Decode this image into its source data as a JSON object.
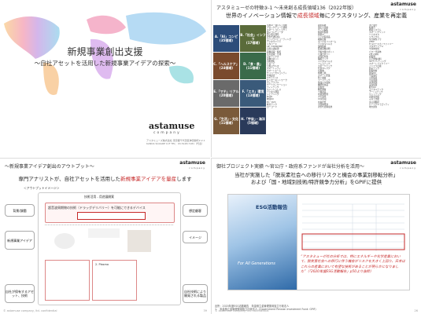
{
  "slide1": {
    "title": "新規事業創出支援",
    "subtitle": "～自社アセットを活用した新規事業アイデアの探索～",
    "logo": "astamuse",
    "logo_sub": "company",
    "address": "アスタミューズ株式会社 東京都千代田区神田錦町2-2-1 KANDA SQUARE 11F TEL：03-5148-7181（代表）"
  },
  "slide2": {
    "title": "アスタミューゼの特徴③-1 ～未来創る成長領域136（2022年版）",
    "heading_pre": "世界のイノベーション情報で",
    "heading_red": "成長領域",
    "heading_post": "毎にクラスタリング、産業を再定義",
    "logo": "astamuse",
    "logo_sub": "company",
    "tiles": [
      {
        "label": "A.「AI」コンピ",
        "sub": "(35領域)",
        "color": "#2d4d7a"
      },
      {
        "label": "B.「社会」インフラ",
        "sub": "(17領域)",
        "color": "#5a6b3a"
      },
      {
        "label": "C.「ヘルスケア」",
        "sub": "(24領域)",
        "color": "#7a4a2d"
      },
      {
        "label": "D.「食・農」",
        "sub": "(11領域)",
        "color": "#3a6b4a"
      },
      {
        "label": "E.「マテ」リアル",
        "sub": "(20領域)",
        "color": "#6a6a6a"
      },
      {
        "label": "F.「エネ」環境",
        "sub": "(13領域)",
        "color": "#3a5a7a"
      },
      {
        "label": "G.「生活」・文化",
        "sub": "(11領域)",
        "color": "#7a5a3a"
      },
      {
        "label": "H.「宇宙」・海洋",
        "sub": "(5領域)",
        "color": "#2a3a5a"
      }
    ],
    "list_col1": [
      "汎用AI・強い人工知能",
      "ブロックチェーン技術",
      "スマートコントラクト",
      "量子コンピュータ",
      "量子暗号通信",
      "次世代通信6G",
      "エッジコンピューティング",
      "デジタルツイン",
      "メタバース",
      "XR（VR/AR/MR）",
      "自然言語処理",
      "画像認識・解析",
      "音声認識・合成",
      "ロボティクス",
      "協働ロボット",
      "自動運転",
      "ドローン",
      "空飛ぶクルマ",
      "スマートシティ",
      "スマートホーム",
      "サイバーセキュリティ",
      "生体認証",
      "IoTデバイス",
      "センサーネットワーク",
      "ウェアラブル",
      "ゲーミフィケーション",
      "フィンテック",
      "キャッシュレス",
      "デジタル通貨",
      "シェアリング",
      "MaaS",
      "物流DX",
      "EC・D2C",
      "教育テック",
      "ローコード"
    ],
    "list_col2": [
      "再生医療",
      "遺伝子治療",
      "ゲノム編集",
      "個別化医療",
      "創薬AI",
      "バイオ医薬品",
      "細胞培養",
      "マイクロバイオーム",
      "デジタルヘルス",
      "遠隔医療",
      "医療画像診断",
      "手術支援ロボット",
      "介護ロボット",
      "認知症対策",
      "睡眠テック",
      "メンタルヘルス",
      "フェムテック",
      "スポーツテック",
      "代替タンパク",
      "培養肉",
      "植物工場",
      "スマート農業",
      "陸上養殖",
      "フードテック",
      "食品ロス削減",
      "機能性食品",
      "昆虫食",
      "精密発酵",
      "土壌改良",
      "水資源管理",
      "大気浄化",
      "CO2回収",
      "水素社会",
      "全固体電池",
      "次世代太陽電池"
    ],
    "list_col3": [
      "洋上風力",
      "核融合",
      "蓄電システム",
      "スマートグリッド",
      "バイオマス",
      "リサイクル",
      "生分解性プラ",
      "CFRP",
      "セルロースナノファイバー",
      "メタマテリアル",
      "半導体材料",
      "パワー半導体",
      "2次元材料",
      "超電導",
      "自己修復材料",
      "3Dプリンティング",
      "スマートファクトリー",
      "インフラ点検",
      "防災テック",
      "耐震技術",
      "建設DX",
      "宇宙旅行",
      "小型衛星",
      "宇宙資源",
      "海洋資源",
      "深海探査",
      "観光DX",
      "エンタメテック",
      "アート×テック",
      "ペットテック",
      "高齢者支援",
      "子育て支援",
      "多言語翻訳",
      "パーソナルモビリティ",
      "地方創生"
    ]
  },
  "slide3": {
    "title": "～新規事業アイデア創出のアウトプット～",
    "heading_pre": "専門アナリストが、自社アセットを活用した",
    "heading_red": "新規事業アイデアを量産",
    "heading_post": "します",
    "label_outline": "＜アウトプットイメージ＞",
    "tab_a": "技術活用 - 用途展開案",
    "panel_title": "超音波周期物の技術（ドラッグデリバリー）を可能にできるデバイス",
    "left_boxes": [
      "背景/課題",
      "新規事業アイデア",
      "自社が保有するアセット、技術"
    ],
    "right_boxes": [
      "想定顧客",
      "イメージ",
      "自社技術により開発される製品"
    ],
    "card_title": "2. Plasma",
    "footer_left": "© astamuse company, ltd. confidential",
    "page": "39"
  },
  "slide4": {
    "title": "御社プロジェクト実績 ～官公庁・政府系ファンドが当社分析を活用～",
    "heading_line1": "当社が実施した「脱炭素社会への移行リスクと機会の事業別移転分析」",
    "heading_line2": "および「国・地域別技術/特許競争力分析」をGPIFに提供",
    "book_title": "ESG活動報告",
    "book_label": "For All Generations",
    "quote": "“アスタミューゼ社の分析では、特にエネルギーや化学産業において、脱炭素社会への移行に伴う機会がリスクを大きく上回り、日本はこれらの産業において有望な技術があることが明らかになりました”（「2020年度ESG活動報告」p50より抜粋）",
    "note1": "出所：2020年度ESG活動報告　年金積立金管理運用独立行政法人",
    "note2": "1.　年金積立金管理運用独立行政法人（Government Pension Investment Fund: GPIF）",
    "footer_left": "© astamuse company, ltd. confidential",
    "page": "26"
  }
}
